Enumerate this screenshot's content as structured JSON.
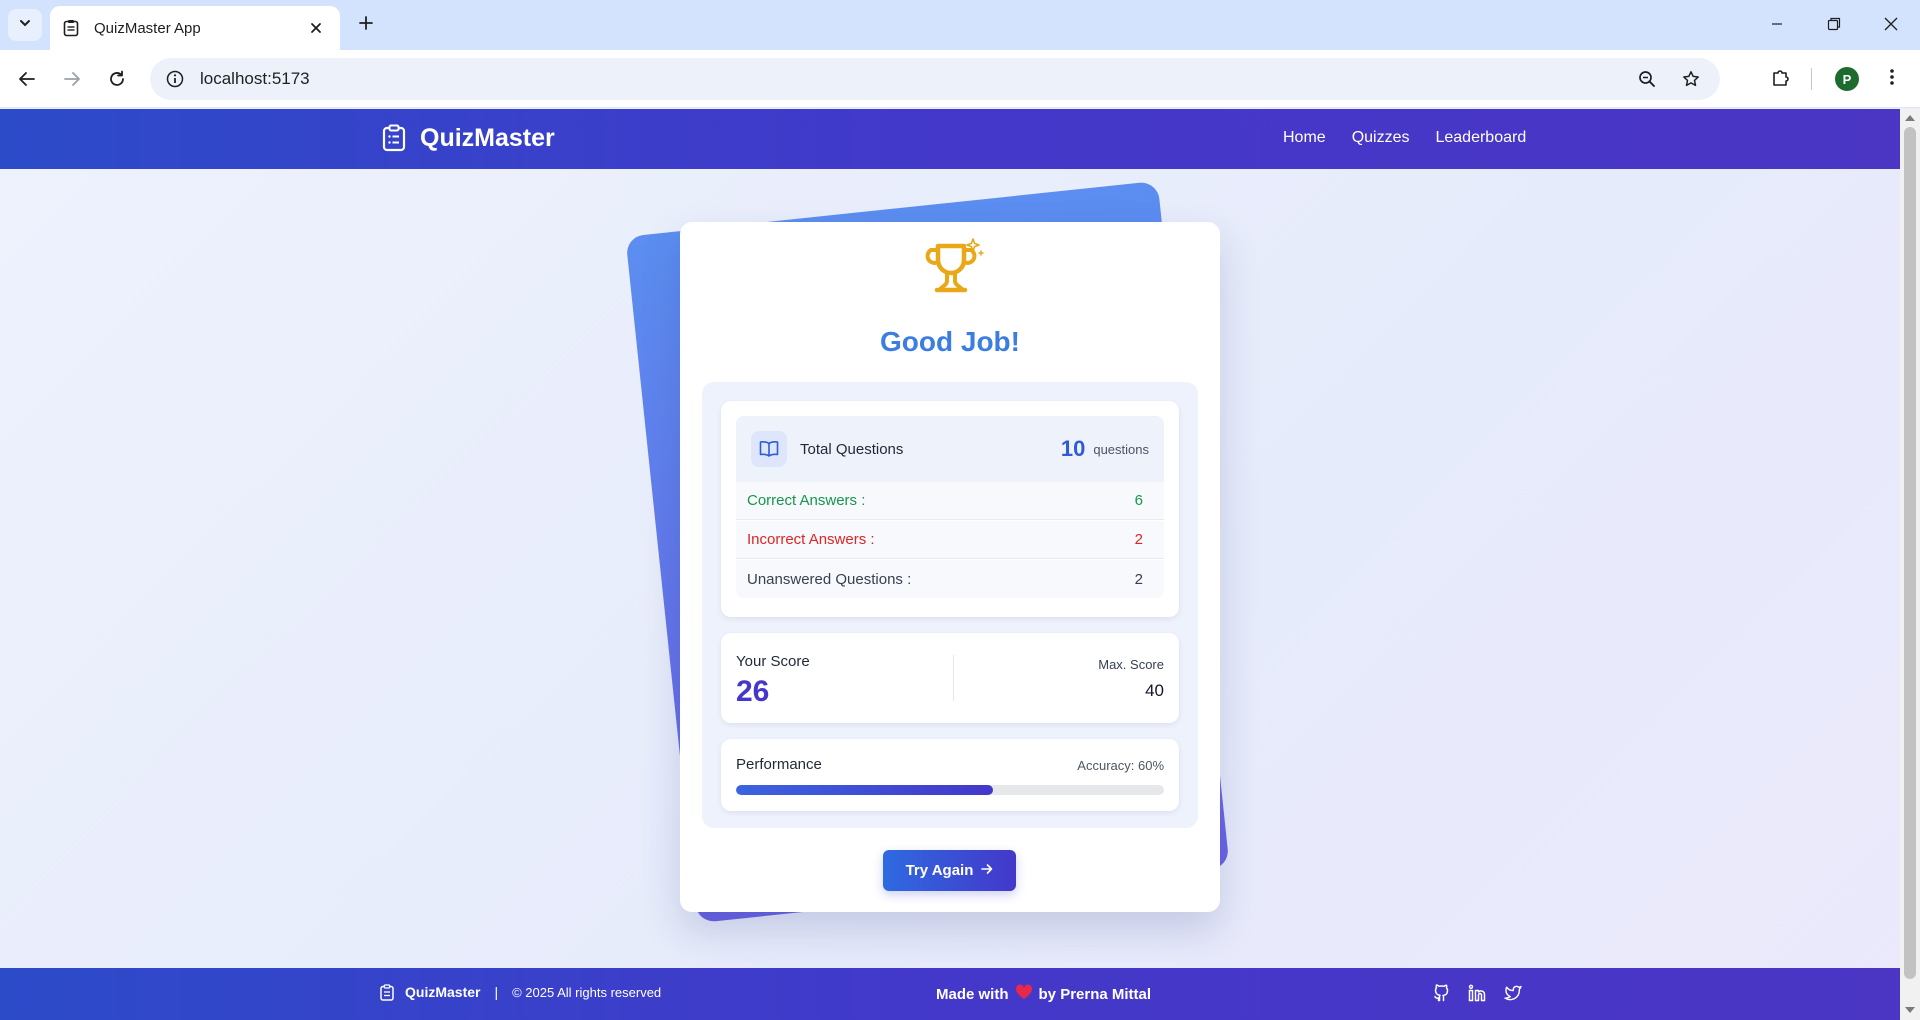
{
  "browser": {
    "tab_title": "QuizMaster App",
    "url": "localhost:5173",
    "profile_initial": "P"
  },
  "navbar": {
    "brand": "QuizMaster",
    "links": [
      "Home",
      "Quizzes",
      "Leaderboard"
    ]
  },
  "result": {
    "heading": "Good Job!",
    "total_label": "Total Questions",
    "total_value": "10",
    "total_unit": "questions",
    "correct_label": "Correct Answers :",
    "correct_value": "6",
    "incorrect_label": "Incorrect Answers :",
    "incorrect_value": "2",
    "unanswered_label": "Unanswered Questions :",
    "unanswered_value": "2",
    "score_label": "Your Score",
    "score_value": "26",
    "max_label": "Max. Score",
    "max_value": "40",
    "performance_label": "Performance",
    "accuracy_label": "Accuracy: 60%",
    "accuracy_fraction": 0.6,
    "try_again": "Try Again"
  },
  "footer": {
    "brand": "QuizMaster",
    "separator": "|",
    "copyright": "© 2025 All rights reserved",
    "made_with": "Made with",
    "by": "by Prerna Mittal"
  },
  "colors": {
    "brand_primary": "#4338ca",
    "heading_blue": "#3b7de0",
    "correct_green": "#17964a",
    "incorrect_red": "#dc2626",
    "trophy_gold": "#e8a817"
  },
  "icons": [
    "clipboard-icon",
    "book-open-icon",
    "trophy-icon",
    "sparkle-icon",
    "arrow-right-icon",
    "heart-icon",
    "github-icon",
    "linkedin-icon",
    "twitter-icon"
  ]
}
